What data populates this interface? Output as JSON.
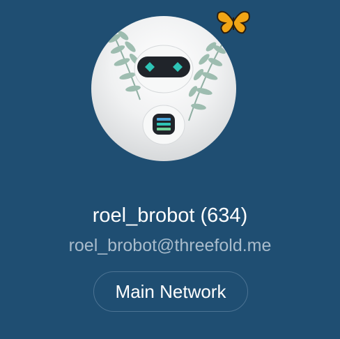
{
  "profile": {
    "display_name": "roel_brobot (634)",
    "email": "roel_brobot@threefold.me",
    "network_label": "Main Network",
    "avatar": "robot-avatar",
    "decoration": "butterfly-icon"
  },
  "colors": {
    "background": "#1f4e72",
    "email_text": "#a9bccc",
    "button_border": "#4c7393",
    "robot_eyes": "#2ec4b6",
    "butterfly": "#f2a516"
  }
}
